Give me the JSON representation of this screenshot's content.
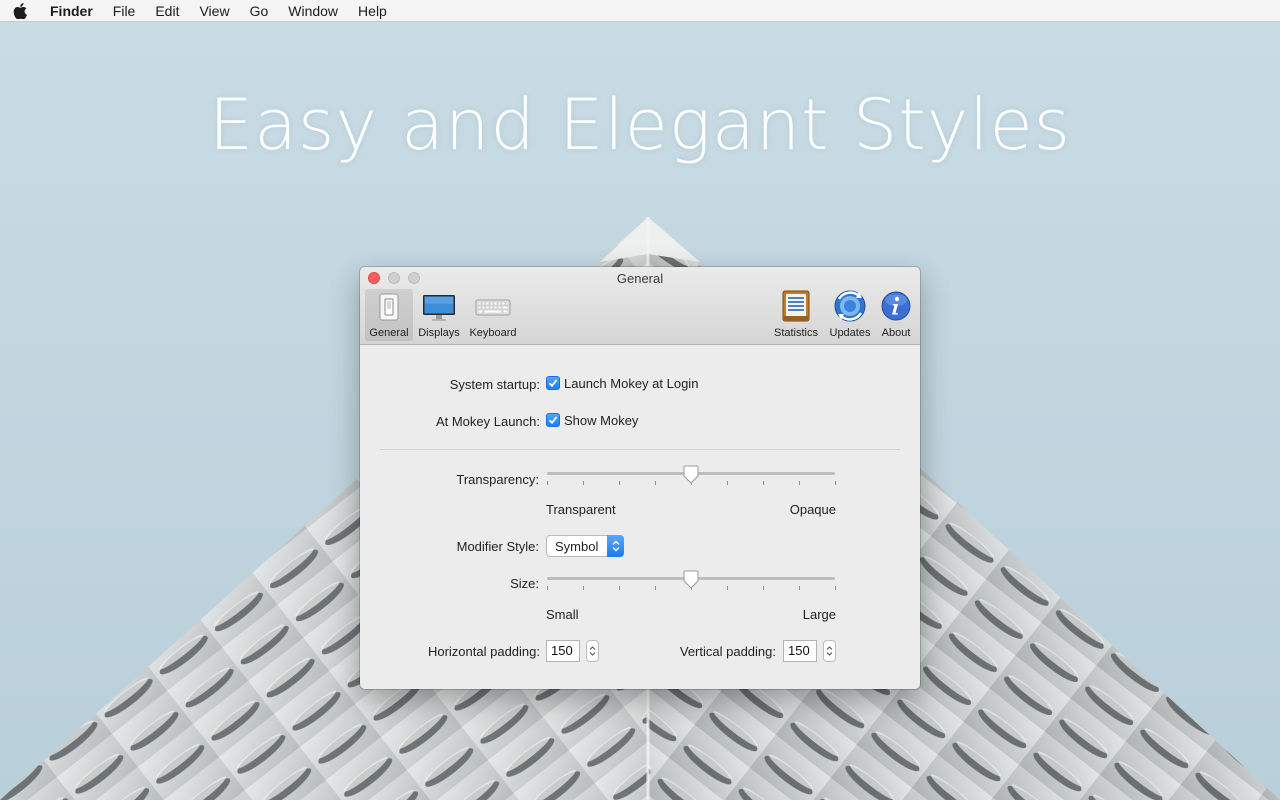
{
  "menubar": {
    "app": "Finder",
    "items": [
      "File",
      "Edit",
      "View",
      "Go",
      "Window",
      "Help"
    ]
  },
  "headline": "Easy and Elegant Styles",
  "window": {
    "title": "General",
    "toolbar": {
      "left": [
        "General",
        "Displays",
        "Keyboard"
      ],
      "right": [
        "Statistics",
        "Updates",
        "About"
      ],
      "selected": "General"
    },
    "general": {
      "system_startup_label": "System startup:",
      "launch_at_login_label": "Launch Mokey at Login",
      "launch_at_login_checked": true,
      "at_launch_label": "At Mokey Launch:",
      "show_mokey_label": "Show Mokey",
      "show_mokey_checked": true,
      "transparency_label": "Transparency:",
      "transparency_min": "Transparent",
      "transparency_max": "Opaque",
      "transparency_value": 0.5,
      "modifier_style_label": "Modifier Style:",
      "modifier_style_value": "Symbol",
      "size_label": "Size:",
      "size_min": "Small",
      "size_max": "Large",
      "size_value": 0.5,
      "h_padding_label": "Horizontal padding:",
      "h_padding_value": "150",
      "v_padding_label": "Vertical padding:",
      "v_padding_value": "150"
    }
  },
  "colors": {
    "accent": "#1f7ef5",
    "close": "#fc605c"
  }
}
